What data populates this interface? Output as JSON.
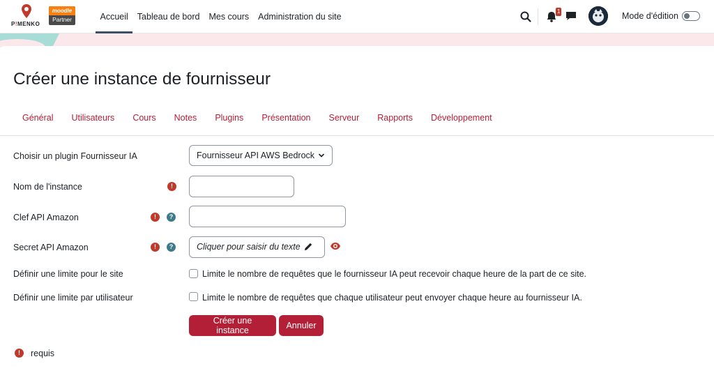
{
  "brand": {
    "logo_text_pre": "P",
    "logo_text_accent": "!",
    "logo_text_post": "MENKO",
    "partner_top": "moodle",
    "partner_bottom": "Partner"
  },
  "nav": {
    "links": [
      "Accueil",
      "Tableau de bord",
      "Mes cours",
      "Administration du site"
    ],
    "active_index": 0,
    "notification_count": "1",
    "edit_mode_label": "Mode d'édition",
    "edit_mode_on": false
  },
  "page": {
    "title": "Créer une instance de fournisseur",
    "tabs": [
      "Général",
      "Utilisateurs",
      "Cours",
      "Notes",
      "Plugins",
      "Présentation",
      "Serveur",
      "Rapports",
      "Développement"
    ]
  },
  "form": {
    "plugin_label": "Choisir un plugin Fournisseur IA",
    "plugin_value": "Fournisseur API AWS Bedrock",
    "instance_name_label": "Nom de l'instance",
    "instance_name_value": "",
    "api_key_label": "Clef API Amazon",
    "api_key_value": "",
    "api_secret_label": "Secret API Amazon",
    "api_secret_placeholder": "Cliquer pour saisir du texte",
    "site_limit_label": "Définir une limite pour le site",
    "site_limit_text": "Limite le nombre de requêtes que le fournisseur IA peut recevoir chaque heure de la part de ce site.",
    "user_limit_label": "Définir une limite par utilisateur",
    "user_limit_text": "Limite le nombre de requêtes que chaque utilisateur peut envoyer chaque heure au fournisseur IA.",
    "submit_label": "Créer une instance",
    "cancel_label": "Annuler",
    "required_legend": "requis"
  },
  "icons": {
    "required": "exclamation-circle-icon",
    "help": "question-circle-icon",
    "reveal": "eye-icon",
    "edit": "pencil-icon"
  },
  "colors": {
    "primary": "#b21f36",
    "required": "#c0392b",
    "help": "#3d7b8a",
    "banner": "#fbe8ea"
  }
}
